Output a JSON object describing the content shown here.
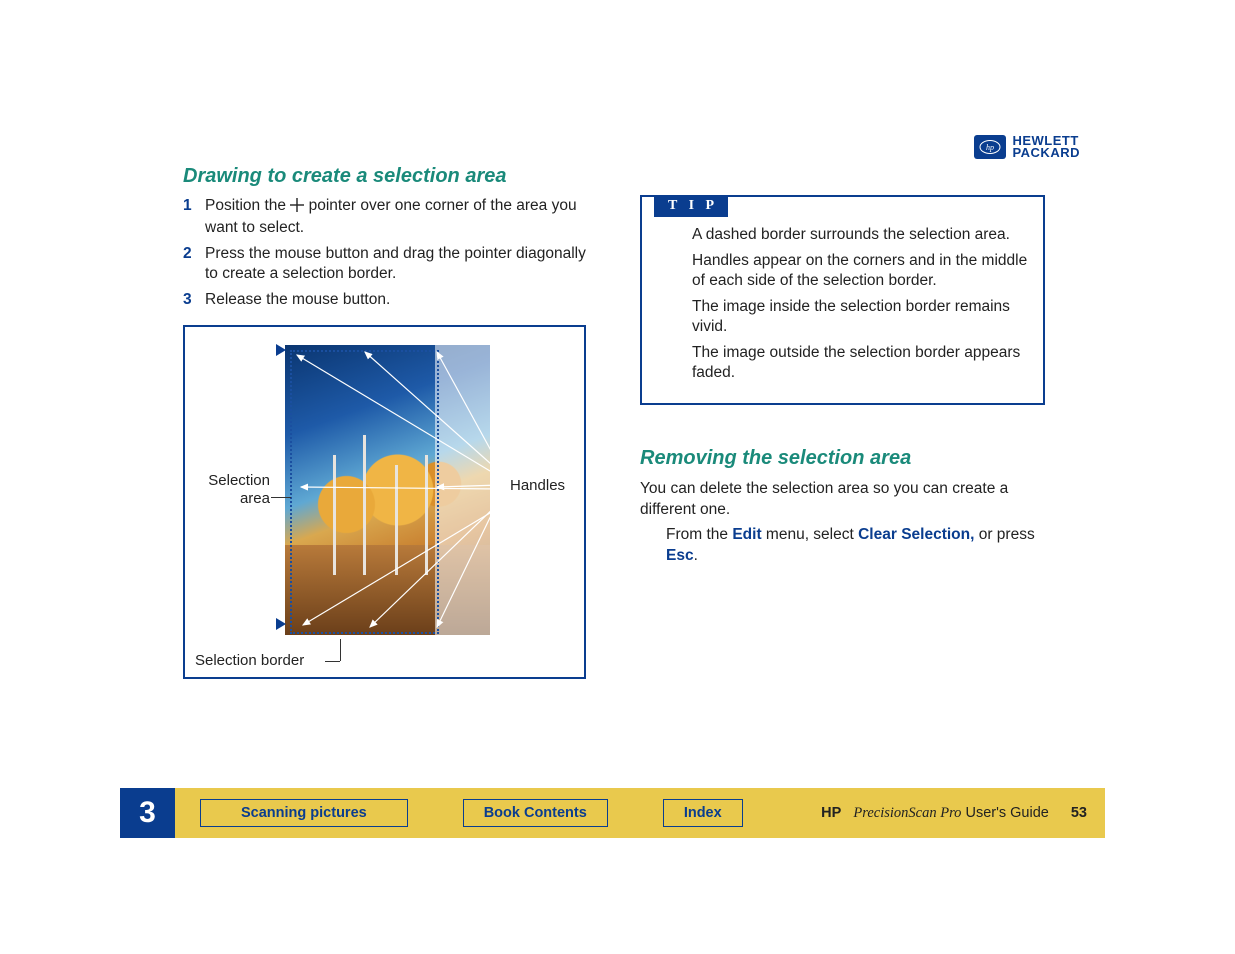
{
  "logo": {
    "line1": "HEWLETT",
    "line2": "PACKARD"
  },
  "left": {
    "heading": "Drawing to create a selection area",
    "steps": [
      {
        "n": "1",
        "before": "Position the ",
        "after": " pointer over one corner of the area you want to select."
      },
      {
        "n": "2",
        "text": "Press the mouse button and drag the pointer diagonally to create a selection border."
      },
      {
        "n": "3",
        "text": "Release the mouse button."
      }
    ],
    "callouts": {
      "selection_area_l1": "Selection",
      "selection_area_l2": "area",
      "handles": "Handles",
      "selection_border": "Selection border"
    }
  },
  "right": {
    "tip_label": "T I P",
    "tips": [
      "A dashed border surrounds the selection area.",
      "Handles appear on the corners and in the middle of each side of the selection border.",
      "The image inside the selection border remains vivid.",
      "The image outside the selection border appears faded."
    ],
    "remove_heading": "Removing the selection area",
    "remove_p1": "You can delete the selection area so you can create a different one.",
    "remove_p2a": "From the ",
    "remove_kw1": "Edit",
    "remove_p2b": " menu, select ",
    "remove_kw2": "Clear Selection,",
    "remove_p2c": " or press ",
    "remove_kw3": "Esc",
    "remove_p2d": "."
  },
  "footer": {
    "chapter": "3",
    "btn1": "Scanning pictures",
    "btn2": "Book Contents",
    "btn3": "Index",
    "hp": "HP",
    "product": "PrecisionScan Pro",
    "suffix": " User's Guide",
    "page": "53"
  }
}
